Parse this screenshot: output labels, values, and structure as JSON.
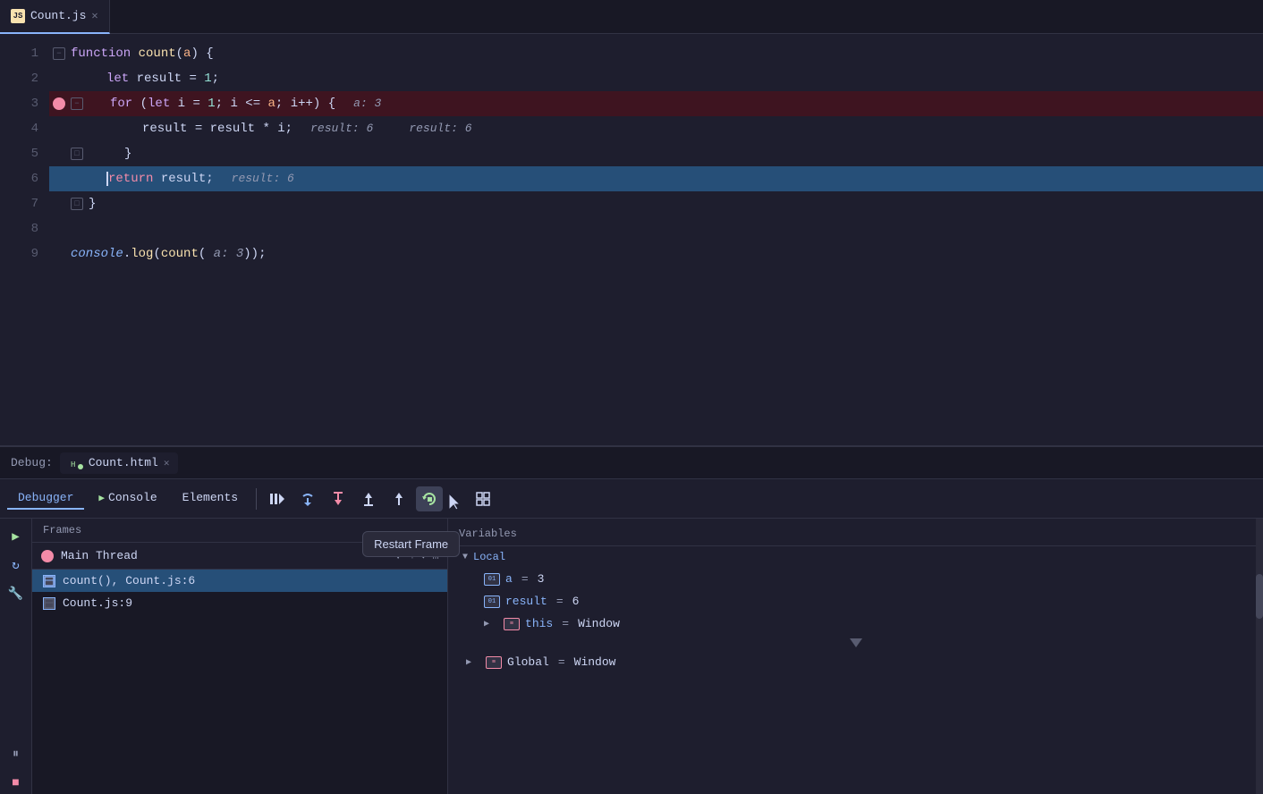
{
  "editor": {
    "tab": {
      "label": "Count.js",
      "icon": "JS"
    },
    "lines": [
      {
        "num": 1,
        "indent": 0,
        "content": "function count(a) {",
        "marker": "fold-open"
      },
      {
        "num": 2,
        "indent": 1,
        "content": "let result = 1;",
        "marker": "none"
      },
      {
        "num": 3,
        "indent": 1,
        "content": "for (let i = 1; i <= a; i++) {",
        "marker": "breakpoint",
        "debug_hint": "a: 3",
        "is_breakpoint_line": true
      },
      {
        "num": 4,
        "indent": 2,
        "content": "result = result * i;",
        "marker": "none",
        "debug_hint": "result: 6     result: 6"
      },
      {
        "num": 5,
        "indent": 2,
        "content": "}",
        "marker": "fold"
      },
      {
        "num": 6,
        "indent": 1,
        "content": "return result;",
        "marker": "none",
        "debug_hint": "result: 6",
        "is_current_line": true
      },
      {
        "num": 7,
        "indent": 0,
        "content": "}",
        "marker": "fold"
      },
      {
        "num": 8,
        "indent": 0,
        "content": "",
        "marker": "none"
      },
      {
        "num": 9,
        "indent": 0,
        "content": "console.log(count( a: 3));",
        "marker": "none"
      }
    ],
    "call_hint": "count()"
  },
  "debug_bar": {
    "label": "Debug:",
    "file_tab": "Count.html"
  },
  "toolbar": {
    "tabs": [
      "Debugger",
      "Console",
      "Elements"
    ],
    "active_tab": "Debugger",
    "buttons": [
      {
        "name": "resume",
        "icon": "≡",
        "tooltip": ""
      },
      {
        "name": "step-over",
        "icon": "↗",
        "tooltip": ""
      },
      {
        "name": "step-into",
        "icon": "↓",
        "tooltip": ""
      },
      {
        "name": "step-out",
        "icon": "↑↓",
        "tooltip": ""
      },
      {
        "name": "step-out2",
        "icon": "↑",
        "tooltip": ""
      },
      {
        "name": "restart-frame",
        "icon": "↺",
        "tooltip": "Restart Frame",
        "active": true
      },
      {
        "name": "deactivate",
        "icon": "⊘",
        "tooltip": ""
      },
      {
        "name": "grid",
        "icon": "⊞",
        "tooltip": ""
      }
    ]
  },
  "frames": {
    "header": "Frames",
    "thread": "Main Thread",
    "items": [
      {
        "func": "count(), Count.js:6",
        "selected": true
      },
      {
        "func": "Count.js:9",
        "selected": false
      }
    ]
  },
  "variables": {
    "header": "Variables",
    "local_label": "Local",
    "items": [
      {
        "name": "a",
        "value": "3",
        "type": "01"
      },
      {
        "name": "result",
        "value": "6",
        "type": "01"
      }
    ],
    "this_label": "this",
    "this_value": "= Window",
    "global_label": "Global",
    "global_value": "= Window"
  },
  "controls": {
    "play": "▶",
    "sync": "↻",
    "wrench": "🔧",
    "pause": "⏸",
    "stop": "■"
  }
}
